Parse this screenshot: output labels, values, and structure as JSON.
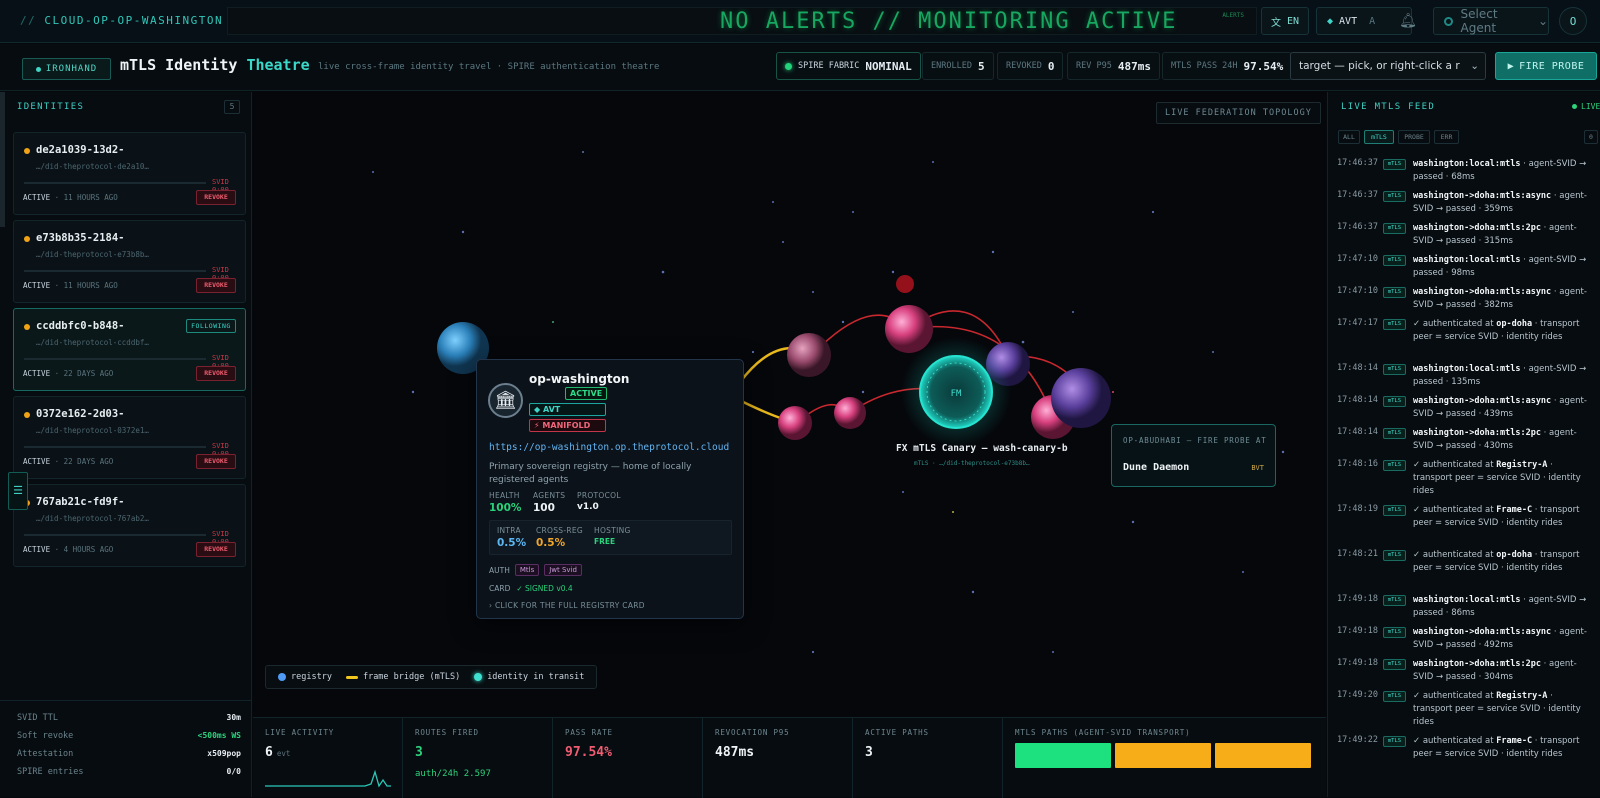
{
  "topbar": {
    "brand_prefix": "//",
    "brand": "CLOUD-OP-OP-WASHINGTON",
    "marquee": "NO ALERTS  //  MONITORING ACTIVE",
    "marquee_small": "ALERTS",
    "lang": "EN",
    "avt_label": "AVT",
    "avt_sub": "A",
    "agent_placeholder": "Select Agent",
    "avatar": "O"
  },
  "header": {
    "badge": "IRONHAND",
    "title": "mTLS Identity",
    "title_accent": "Theatre",
    "subtitle": "live cross-frame identity travel · SPIRE authentication theatre",
    "spire_label": "SPIRE FABRIC",
    "spire_value": "NOMINAL",
    "enrolled_label": "ENROLLED",
    "enrolled_value": "5",
    "revoked_label": "REVOKED",
    "revoked_value": "0",
    "revp95_label": "REV P95",
    "revp95_value": "487ms",
    "pass_label": "MTLS PASS 24H",
    "pass_value": "97.54%",
    "target_placeholder": "target — pick, or right-click a r",
    "fire_label": "FIRE PROBE"
  },
  "identities": {
    "heading": "IDENTITIES",
    "count": "5",
    "items": [
      {
        "name": "de2a1039-13d2-",
        "did": "…/did-theprotocol-de2a10…",
        "svid": "SVID 0:00",
        "status": "ACTIVE",
        "age": "11 HOURS AGO",
        "revoke": "REVOKE"
      },
      {
        "name": "e73b8b35-2184-",
        "did": "…/did-theprotocol-e73b8b…",
        "svid": "SVID 0:00",
        "status": "ACTIVE",
        "age": "11 HOURS AGO",
        "revoke": "REVOKE"
      },
      {
        "name": "ccddbfc0-b848-",
        "did": "…/did-theprotocol-ccddbf…",
        "svid": "SVID 0:00",
        "status": "ACTIVE",
        "age": "22 DAYS AGO",
        "revoke": "REVOKE",
        "following": "FOLLOWING"
      },
      {
        "name": "0372e162-2d03-",
        "did": "…/did-theprotocol-0372e1…",
        "svid": "SVID 0:00",
        "status": "ACTIVE",
        "age": "22 DAYS AGO",
        "revoke": "REVOKE"
      },
      {
        "name": "767ab21c-fd9f-",
        "did": "…/did-theprotocol-767ab2…",
        "svid": "SVID 0:00",
        "status": "ACTIVE",
        "age": "4 HOURS AGO",
        "revoke": "REVOKE"
      }
    ],
    "footer": [
      {
        "k": "SVID TTL",
        "v": "30m"
      },
      {
        "k": "Soft revoke",
        "v": "<500ms WS"
      },
      {
        "k": "Attestation",
        "v": "x509pop"
      },
      {
        "k": "SPIRE entries",
        "v": "0/0"
      }
    ]
  },
  "topology": {
    "tag": "LIVE FEDERATION TOPOLOGY",
    "legend": {
      "registry": "registry",
      "bridge": "frame bridge (mTLS)",
      "identity": "identity in transit"
    },
    "canary_node": "FM",
    "canary_label": "FX mTLS Canary — wash-canary-b",
    "canary_sub": "mTLS · …/did-theprotocol-e73b8b…",
    "probe": {
      "heading": "OP-ABUDHABI — FIRE PROBE AT",
      "name": "Dune Daemon",
      "tag": "BVT"
    }
  },
  "registry_card": {
    "name": "op-washington",
    "status": "ACTIVE",
    "avt": "AVT",
    "manifold": "MANIFOLD",
    "url": "https://op-washington.op.theprotocol.cloud",
    "description": "Primary sovereign registry — home of locally registered agents",
    "health_k": "HEALTH",
    "health_v": "100%",
    "agents_k": "AGENTS",
    "agents_v": "100",
    "protocol_k": "PROTOCOL",
    "protocol_v": "v1.0",
    "intra_k": "INTRA",
    "intra_v": "0.5%",
    "cross_k": "CROSS-REG",
    "cross_v": "0.5%",
    "hosting_k": "HOSTING",
    "hosting_v": "FREE",
    "auth_label": "AUTH",
    "auth_chips": [
      "Mtls",
      "Jwt Svid"
    ],
    "card_label": "CARD",
    "card_value": "✓ SIGNED v0.4",
    "click_hint": "CLICK FOR THE FULL REGISTRY CARD"
  },
  "metrics": {
    "live_k": "LIVE ACTIVITY",
    "live_v": "6",
    "live_u": "evt",
    "routes_k": "ROUTES FIRED",
    "routes_v": "3",
    "routes_s": "auth/24h 2.597",
    "pass_k": "PASS RATE",
    "pass_v": "97.54%",
    "rev_k": "REVOCATION P95",
    "rev_v": "487ms",
    "paths_k": "ACTIVE PATHS",
    "paths_v": "3",
    "mtls_k": "MTLS PATHS (AGENT-SVID TRANSPORT)",
    "mtls_colors": [
      "#1de07f",
      "#f7ad17",
      "#f7ad17"
    ]
  },
  "feed": {
    "heading": "LIVE MTLS FEED",
    "live": "LIVE",
    "filters": [
      "ALL",
      "mTLS",
      "PROBE",
      "ERR"
    ],
    "filter_extra": "0",
    "items": [
      {
        "t": "17:46:37",
        "tag": "mTLS",
        "b": "washington:local:mtls",
        "r": " · agent-SVID → passed · 68ms"
      },
      {
        "t": "17:46:37",
        "tag": "mTLS",
        "b": "washington->doha:mtls:async",
        "r": " · agent-SVID → passed · 359ms"
      },
      {
        "t": "17:46:37",
        "tag": "mTLS",
        "b": "washington->doha:mtls:2pc",
        "r": " · agent-SVID → passed · 315ms"
      },
      {
        "t": "17:47:10",
        "tag": "mTLS",
        "b": "washington:local:mtls",
        "r": " · agent-SVID → passed · 98ms"
      },
      {
        "t": "17:47:10",
        "tag": "mTLS",
        "b": "washington->doha:mtls:async",
        "r": " · agent-SVID → passed · 382ms"
      },
      {
        "t": "17:47:17",
        "tag": "mTLS",
        "a": "✓ authenticated at ",
        "b": "op-doha",
        "r": " · transport peer = service SVID · identity rides"
      },
      {
        "t": "17:48:14",
        "tag": "mTLS",
        "b": "washington:local:mtls",
        "r": " · agent-SVID → passed · 135ms"
      },
      {
        "t": "17:48:14",
        "tag": "mTLS",
        "b": "washington->doha:mtls:async",
        "r": " · agent-SVID → passed · 439ms"
      },
      {
        "t": "17:48:14",
        "tag": "mTLS",
        "b": "washington->doha:mtls:2pc",
        "r": " · agent-SVID → passed · 430ms"
      },
      {
        "t": "17:48:16",
        "tag": "mTLS",
        "a": "✓ authenticated at ",
        "b": "Registry-A",
        "r": " · transport peer = service SVID · identity rides"
      },
      {
        "t": "17:48:19",
        "tag": "mTLS",
        "a": "✓ authenticated at ",
        "b": "Frame-C",
        "r": " · transport peer = service SVID · identity rides"
      },
      {
        "t": "17:48:21",
        "tag": "mTLS",
        "a": "✓ authenticated at ",
        "b": "op-doha",
        "r": " · transport peer = service SVID · identity rides"
      },
      {
        "t": "17:49:18",
        "tag": "mTLS",
        "b": "washington:local:mtls",
        "r": " · agent-SVID → passed · 86ms"
      },
      {
        "t": "17:49:18",
        "tag": "mTLS",
        "b": "washington->doha:mtls:async",
        "r": " · agent-SVID → passed · 492ms"
      },
      {
        "t": "17:49:18",
        "tag": "mTLS",
        "b": "washington->doha:mtls:2pc",
        "r": " · agent-SVID → passed · 304ms"
      },
      {
        "t": "17:49:20",
        "tag": "mTLS",
        "a": "✓ authenticated at ",
        "b": "Registry-A",
        "r": " · transport peer = service SVID · identity rides"
      },
      {
        "t": "17:49:22",
        "tag": "mTLS",
        "a": "✓ authenticated at ",
        "b": "Frame-C",
        "r": " · transport peer = service SVID · identity rides"
      }
    ]
  }
}
